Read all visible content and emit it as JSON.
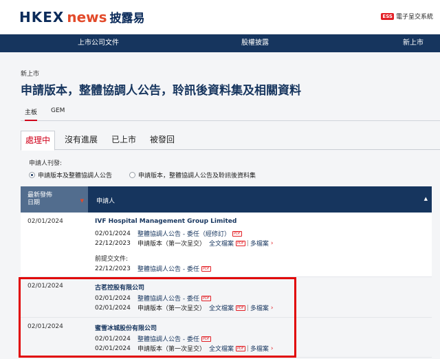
{
  "header": {
    "logo_hkex": "HKEX",
    "logo_news": "news",
    "logo_cn": "披露易",
    "ess_badge": "ESS",
    "ess_label": "電子呈交系統"
  },
  "nav": {
    "items": [
      "上市公司文件",
      "股權披露",
      "新上市"
    ]
  },
  "breadcrumb": "新上市",
  "page_title": "申請版本，整體協調人公告，聆訊後資料集及相關資料",
  "board_tabs": [
    "主板",
    "GEM"
  ],
  "status_tabs": [
    "處理中",
    "沒有進展",
    "已上市",
    "被發回"
  ],
  "filter": {
    "label": "申請人刊發:",
    "options": [
      "申請版本及整體協調人公告",
      "申請版本，整體協調人公告及聆訊後資料集"
    ],
    "selected": 0
  },
  "table": {
    "col_date": "最新發佈日期",
    "col_date_line1": "最新發佈",
    "col_date_line2": "日期",
    "col_applicant": "申請人",
    "rows": [
      {
        "date": "02/01/2024",
        "name": "IVF Hospital Management Group Limited",
        "lines": [
          {
            "date": "02/01/2024",
            "text": "整體協調人公告 - 委任（經修訂）",
            "pdf": "PDF"
          },
          {
            "date": "22/12/2023",
            "text": "申請版本（第一次呈交）",
            "full": "全文檔案",
            "pdf": "PDF",
            "multi": "多檔案"
          }
        ],
        "prev_label": "前提交文件:",
        "prev_lines": [
          {
            "date": "22/12/2023",
            "text": "整體協調人公告 - 委任",
            "pdf": "PDF"
          }
        ]
      },
      {
        "date": "02/01/2024",
        "name": "古茗控股有限公司",
        "lines": [
          {
            "date": "02/01/2024",
            "text": "整體協調人公告 - 委任",
            "pdf": "PDF"
          },
          {
            "date": "02/01/2024",
            "text": "申請版本（第一次呈交）",
            "full": "全文檔案",
            "pdf": "PDF",
            "multi": "多檔案"
          }
        ]
      },
      {
        "date": "02/01/2024",
        "name": "蜜雪冰城股份有限公司",
        "lines": [
          {
            "date": "02/01/2024",
            "text": "整體協調人公告 - 委任",
            "pdf": "PDF"
          },
          {
            "date": "02/01/2024",
            "text": "申請版本（第一次呈交）",
            "full": "全文檔案",
            "pdf": "PDF",
            "multi": "多檔案"
          }
        ]
      }
    ]
  },
  "colors": {
    "navy": "#16355e",
    "red": "#d0021b",
    "highlight": "#e10000"
  }
}
